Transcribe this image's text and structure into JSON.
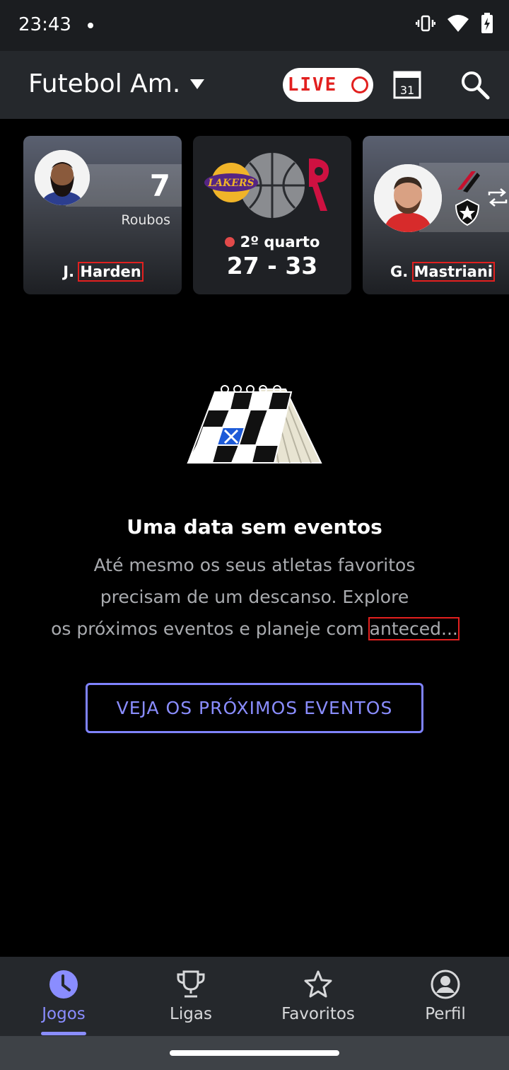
{
  "status_bar": {
    "time": "23:43"
  },
  "header": {
    "title": "Futebol Am.",
    "live_label": "LIVE",
    "calendar_day": "31"
  },
  "cards": [
    {
      "type": "player-stat",
      "stat_value": "7",
      "stat_label": "Roubos",
      "name_initial": "J.",
      "name_last": "Harden"
    },
    {
      "type": "game",
      "status": "2º quarto",
      "score": "27 - 33",
      "home_logo_text": "LAKERS"
    },
    {
      "type": "player-transfer",
      "name_initial": "G.",
      "name_last": "Mastriani"
    }
  ],
  "empty_state": {
    "title": "Uma data sem eventos",
    "line1": "Até mesmo os seus atletas favoritos",
    "line2": "precisam de um descanso. Explore",
    "line3_prefix": "os próximos eventos e planeje com ",
    "line3_truncated": "anteced...",
    "button_label": "VEJA OS PRÓXIMOS EVENTOS"
  },
  "bottom_nav": {
    "items": [
      {
        "label": "Jogos",
        "icon": "clock-icon",
        "active": true
      },
      {
        "label": "Ligas",
        "icon": "trophy-icon",
        "active": false
      },
      {
        "label": "Favoritos",
        "icon": "star-icon",
        "active": false
      },
      {
        "label": "Perfil",
        "icon": "profile-icon",
        "active": false
      }
    ]
  },
  "colors": {
    "accent": "#8a8dff",
    "live_red": "#e2201f",
    "header_bg": "#25282c",
    "background": "#000000"
  }
}
